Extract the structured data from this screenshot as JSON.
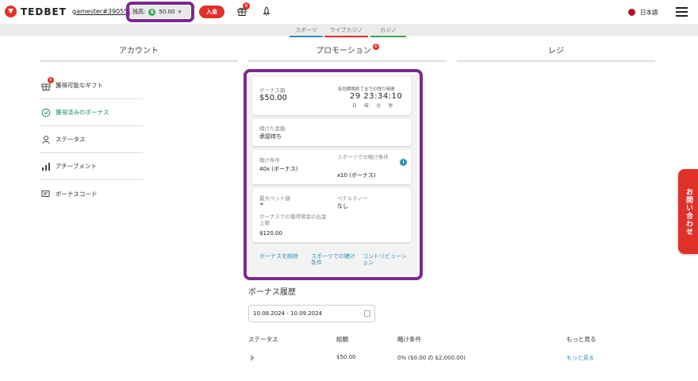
{
  "header": {
    "logo_text": "TEDBET",
    "username": "gamester#390552",
    "balance_label": "残高:",
    "balance_currency_icon": "$",
    "balance_value": "50.00",
    "deposit_label": "入金",
    "gift_badge": "6",
    "language": "日本語"
  },
  "subnav": {
    "tabs": [
      "スポーツ",
      "ライブカジノ",
      "カジノ"
    ]
  },
  "columns": {
    "account": "アカウント",
    "promotion": "プロモーション",
    "promotion_badge": "6",
    "register": "レジ"
  },
  "sidebar": {
    "items": [
      {
        "label": "獲得可能なギフト",
        "icon": "gift-icon",
        "badge": "6"
      },
      {
        "label": "獲得済みのボーナス",
        "icon": "bonus-icon"
      },
      {
        "label": "ステータス",
        "icon": "status-icon"
      },
      {
        "label": "アチーブメント",
        "icon": "achievement-icon"
      },
      {
        "label": "ボーナスコード",
        "icon": "bonus-code-icon"
      }
    ]
  },
  "bonus_card": {
    "bonus_amount_label": "ボーナス額",
    "bonus_amount": "$50.00",
    "expiry_label": "有効期限終了までの残り時間",
    "expiry_value": "29 23:34:10",
    "expiry_units": "日 時 分 秒",
    "wagered_label": "賭けた金額",
    "wagered_value": "承認待ち",
    "wager_req_label": "賭け条件",
    "wager_req_value": "40x (ボーナス)",
    "sports_wager_label": "スポーツでの賭け条件",
    "sports_wager_value": "x10 (ボーナス)",
    "max_bet_label": "最大ベット額",
    "max_bet_value": "∞",
    "penalty_label": "ペナルティー",
    "penalty_value": "なし",
    "withdraw_cap_label": "ボーナスでの獲得賞金の出金上限",
    "withdraw_cap_value": "$120.00",
    "links": {
      "delete": "ボーナスを削除",
      "sports_terms": "スポーツでの賭け条件",
      "contribution": "コントリビューション"
    }
  },
  "history": {
    "title": "ボーナス履歴",
    "date_range": "10.08.2024 - 10.09.2024",
    "columns": [
      "ステータス",
      "総額",
      "賭け条件",
      "もっと見る"
    ],
    "rows": [
      {
        "amount": "$50.00",
        "wager": "0% ($0.00 の $2,000.00)",
        "more": "もっと見る"
      }
    ]
  },
  "contact_tab": "お問い合わせ",
  "colors": {
    "brand_red": "#e0302a",
    "highlight_purple": "#7a2a8f",
    "link_blue": "#2f8fb7",
    "active_green": "#2a8c5a"
  }
}
